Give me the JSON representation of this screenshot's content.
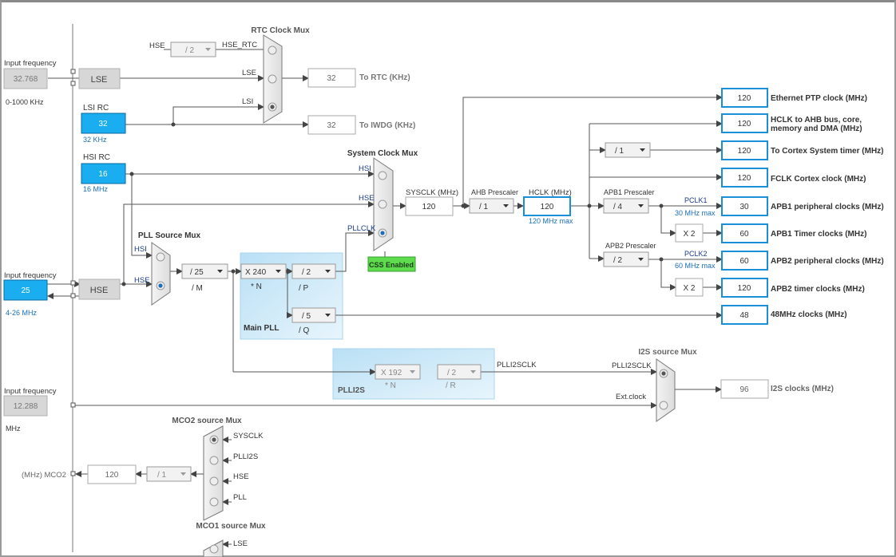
{
  "colors": {
    "wire": "#555555",
    "blue_box": "#1a8fd8",
    "cyan_fill": "#1aaef0",
    "green": "#5fdc4e",
    "label_blue": "#1a6fb8",
    "plls_bg": "#c6e7f7",
    "gray_box": "#d7d7d7"
  },
  "left": {
    "in_freq_label_1": "Input frequency",
    "lse_input": "32.768",
    "lse_range": "0-1000 KHz",
    "lse_box": "LSE",
    "lsi_title": "LSI RC",
    "lsi_value": "32",
    "lsi_unit": "32 KHz",
    "hsi_title": "HSI RC",
    "hsi_value": "16",
    "hsi_unit": "16 MHz",
    "in_freq_label_2": "Input frequency",
    "hse_input": "25",
    "hse_range": "4-26 MHz",
    "hse_box": "HSE",
    "in_freq_label_3": "Input frequency",
    "i2s_input": "12.288",
    "i2s_unit": "MHz"
  },
  "rtc": {
    "title": "RTC Clock Mux",
    "hse_label": "HSE",
    "div": "/ 2",
    "hse_rtc": "HSE_RTC",
    "lse": "LSE",
    "lsi": "LSI",
    "rtc_value": "32",
    "rtc_label": "To RTC (KHz)",
    "iwdg_value": "32",
    "iwdg_label": "To IWDG (KHz)"
  },
  "sysmux": {
    "title": "System Clock Mux",
    "hsi": "HSI",
    "hse": "HSE",
    "pllclk": "PLLCLK",
    "css": "CSS Enabled"
  },
  "pllsrc": {
    "title": "PLL Source Mux",
    "hsi": "HSI",
    "hse": "HSE",
    "m_div": "/ 25",
    "m_label": "/ M"
  },
  "mainpll": {
    "title": "Main PLL",
    "n": "X 240",
    "n_label": "* N",
    "p": "/ 2",
    "p_label": "/ P",
    "q": "/ 5",
    "q_label": "/ Q"
  },
  "sys": {
    "sysclk_label": "SYSCLK (MHz)",
    "sysclk": "120",
    "ahb_label": "AHB Prescaler",
    "ahb": "/ 1",
    "hclk_label": "HCLK (MHz)",
    "hclk": "120",
    "hclk_max": "120 MHz max",
    "cortex_div": "/ 1",
    "apb1_label": "APB1 Prescaler",
    "apb1": "/ 4",
    "pclk1": "PCLK1",
    "pclk1_max": "30 MHz max",
    "x2a": "X 2",
    "apb2_label": "APB2 Prescaler",
    "apb2": "/ 2",
    "pclk2": "PCLK2",
    "pclk2_max": "60 MHz max",
    "x2b": "X 2"
  },
  "outputs": [
    {
      "value": "120",
      "label": "Ethernet PTP clock (MHz)"
    },
    {
      "value": "120",
      "label": "HCLK to AHB bus, core,",
      "label2": "memory and DMA (MHz)"
    },
    {
      "value": "120",
      "label": "To Cortex System timer (MHz)"
    },
    {
      "value": "120",
      "label": "FCLK Cortex clock (MHz)"
    },
    {
      "value": "30",
      "label": "APB1 peripheral clocks (MHz)"
    },
    {
      "value": "60",
      "label": "APB1 Timer clocks (MHz)"
    },
    {
      "value": "60",
      "label": "APB2 peripheral clocks (MHz)"
    },
    {
      "value": "120",
      "label": "APB2 timer clocks (MHz)"
    },
    {
      "value": "48",
      "label": "48MHz clocks (MHz)"
    }
  ],
  "plli2s": {
    "title": "PLLI2S",
    "n": "X 192",
    "n_label": "* N",
    "r": "/ 2",
    "r_label": "/ R",
    "out": "PLLI2SCLK"
  },
  "i2smux": {
    "title": "I2S source Mux",
    "plli2sclk": "PLLI2SCLK",
    "ext": "Ext.clock",
    "value": "96",
    "label": "I2S clocks (MHz)"
  },
  "mco2": {
    "title": "MCO2 source Mux",
    "sysclk": "SYSCLK",
    "plli2s": "PLLI2S",
    "hse": "HSE",
    "pll": "PLL",
    "div": "/ 1",
    "value": "120",
    "label": "(MHz) MCO2"
  },
  "mco1": {
    "title": "MCO1 source Mux",
    "lse": "LSE"
  }
}
